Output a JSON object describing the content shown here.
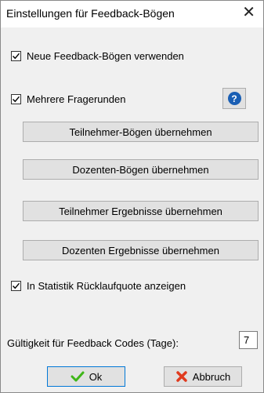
{
  "window": {
    "title": "Einstellungen für Feedback-Bögen",
    "close_symbol": "✕"
  },
  "options": {
    "new_forms": {
      "label": "Neue Feedback-Bögen verwenden",
      "checked": true
    },
    "multiple_rounds": {
      "label": "Mehrere Fragerunden",
      "checked": true
    },
    "show_response_rate": {
      "label": "In Statistik Rücklaufquote anzeigen",
      "checked": true
    }
  },
  "help": {
    "label": "?"
  },
  "buttons": {
    "participant_forms": "Teilnehmer-Bögen übernehmen",
    "lecturer_forms": "Dozenten-Bögen übernehmen",
    "participant_results": "Teilnehmer Ergebnisse übernehmen",
    "lecturer_results": "Dozenten Ergebnisse übernehmen"
  },
  "validity": {
    "label": "Gültigkeit für Feedback Codes (Tage):",
    "value": "7"
  },
  "footer": {
    "ok_label": "Ok",
    "cancel_label": "Abbruch"
  },
  "colors": {
    "ok_icon": "#3fb618",
    "cancel_icon": "#e03a1e",
    "help_icon": "#1a5fb4"
  }
}
